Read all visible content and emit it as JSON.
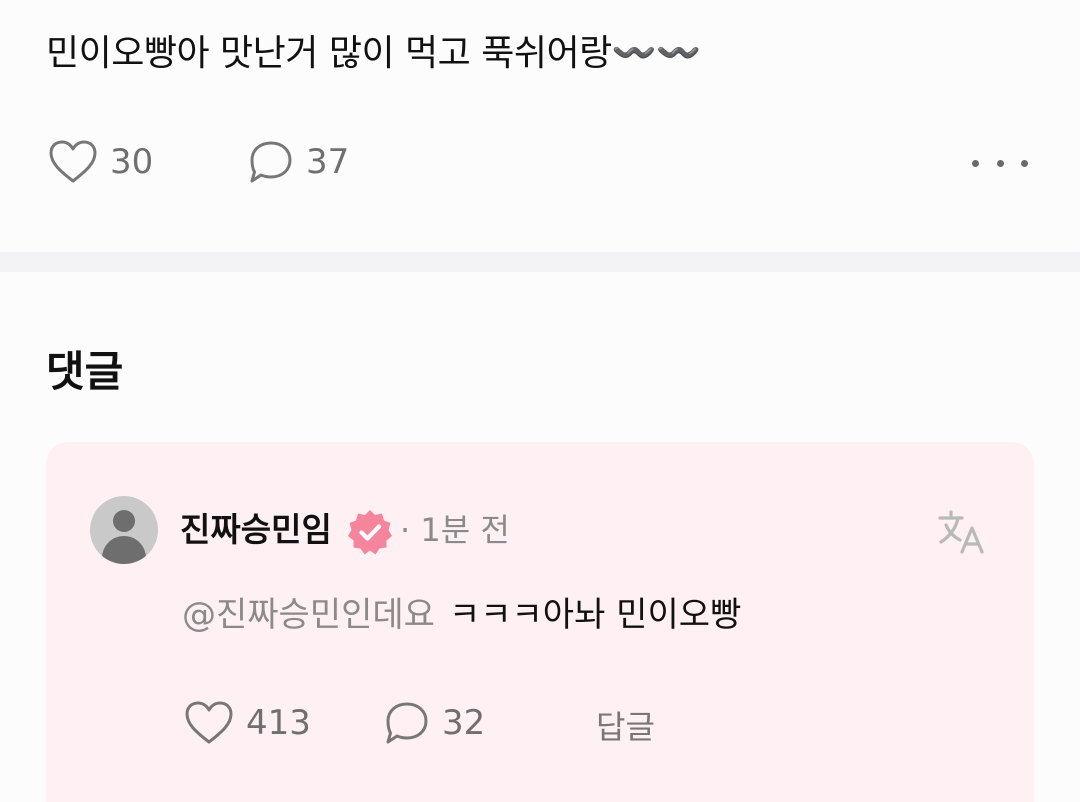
{
  "post": {
    "text": "민이오빵아 맛난거 많이 먹고 푹쉬어랑〰️〰️",
    "like_count": "30",
    "comment_count": "37"
  },
  "comments_section": {
    "title": "댓글"
  },
  "comment": {
    "username": "진짜승민임",
    "separator": "·",
    "time": "1분 전",
    "mention": "@진짜승민인데요",
    "text": "ㅋㅋㅋ아놔 민이오빵",
    "like_count": "413",
    "reply_count": "32",
    "reply_label": "답글"
  },
  "colors": {
    "badge": "#f4859c",
    "comment_card_bg": "#fff0f4",
    "muted_text": "#8a8a8a",
    "avatar_bg": "#c9c9c9"
  },
  "icons": [
    "heart-icon",
    "speech-bubble-icon",
    "more-dots-icon",
    "verified-badge-icon",
    "translate-icon",
    "default-avatar-icon"
  ]
}
